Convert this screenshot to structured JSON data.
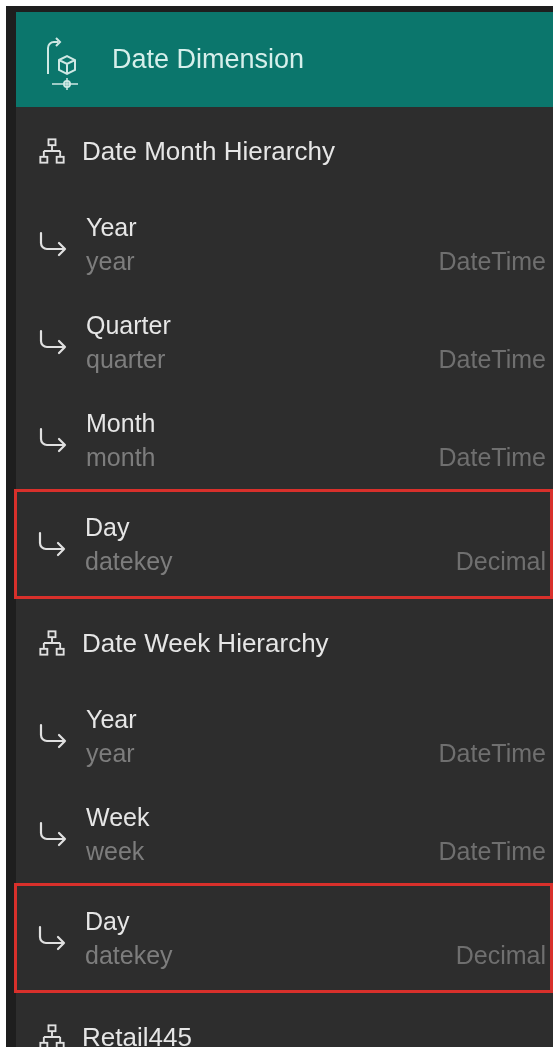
{
  "header": {
    "title": "Date Dimension"
  },
  "hierarchies": [
    {
      "name": "Date Month Hierarchy",
      "levels": [
        {
          "name": "Year",
          "column": "year",
          "type": "DateTime",
          "highlighted": false
        },
        {
          "name": "Quarter",
          "column": "quarter",
          "type": "DateTime",
          "highlighted": false
        },
        {
          "name": "Month",
          "column": "month",
          "type": "DateTime",
          "highlighted": false
        },
        {
          "name": "Day",
          "column": "datekey",
          "type": "Decimal",
          "highlighted": true
        }
      ]
    },
    {
      "name": "Date Week Hierarchy",
      "levels": [
        {
          "name": "Year",
          "column": "year",
          "type": "DateTime",
          "highlighted": false
        },
        {
          "name": "Week",
          "column": "week",
          "type": "DateTime",
          "highlighted": false
        },
        {
          "name": "Day",
          "column": "datekey",
          "type": "Decimal",
          "highlighted": true
        }
      ]
    },
    {
      "name": "Retail445"
    }
  ]
}
